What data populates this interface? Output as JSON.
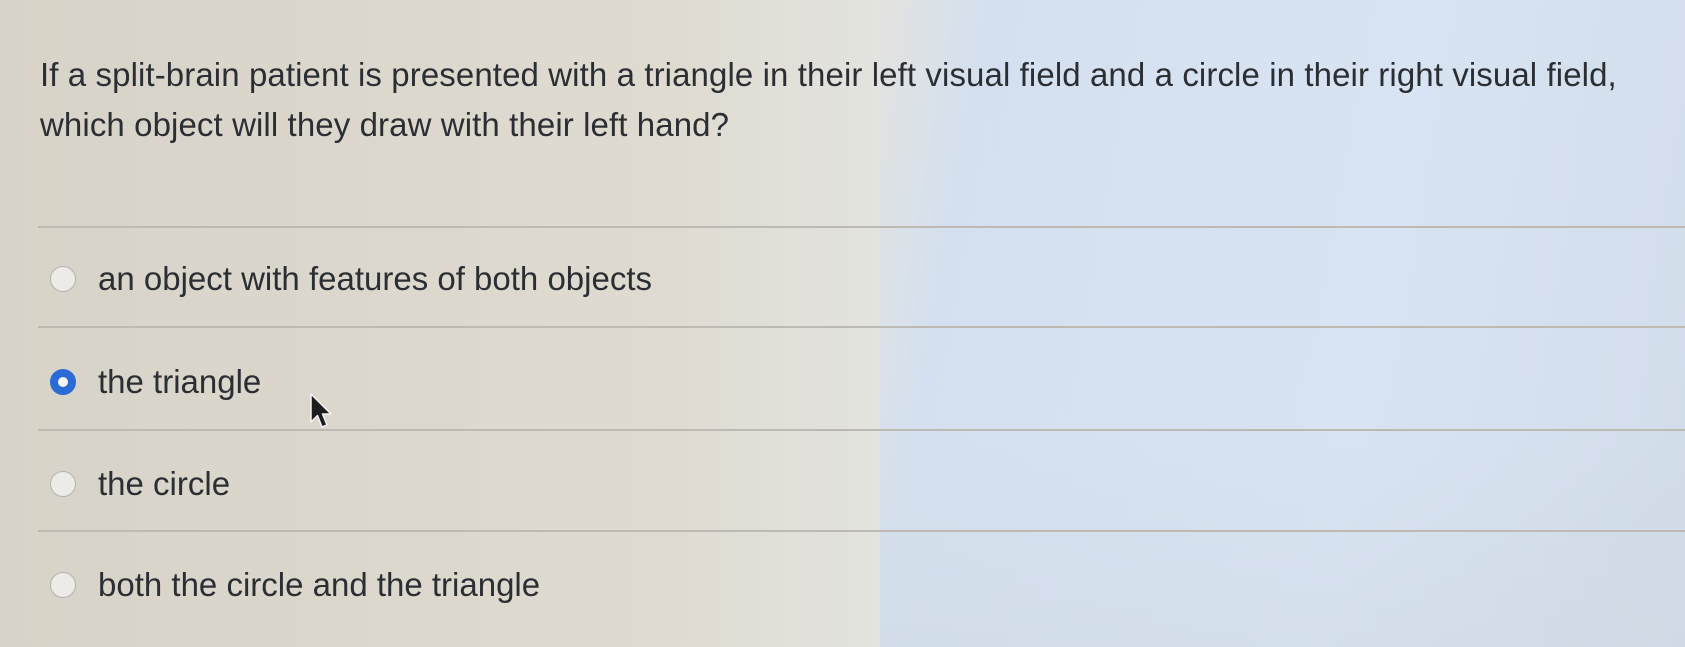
{
  "question": {
    "text": "If a split-brain patient is presented with a triangle in their left visual field and a circle in their right visual field, which object will they draw with their left hand?"
  },
  "options": [
    {
      "label": "an object with features of both objects",
      "selected": false
    },
    {
      "label": "the triangle",
      "selected": true
    },
    {
      "label": "the circle",
      "selected": false
    },
    {
      "label": "both the circle and the triangle",
      "selected": false
    }
  ],
  "colors": {
    "accent": "#2a6bd8",
    "text": "#2b2e33",
    "divider": "#bdbab3"
  },
  "icons": {
    "cursor": "mouse-pointer-icon"
  }
}
